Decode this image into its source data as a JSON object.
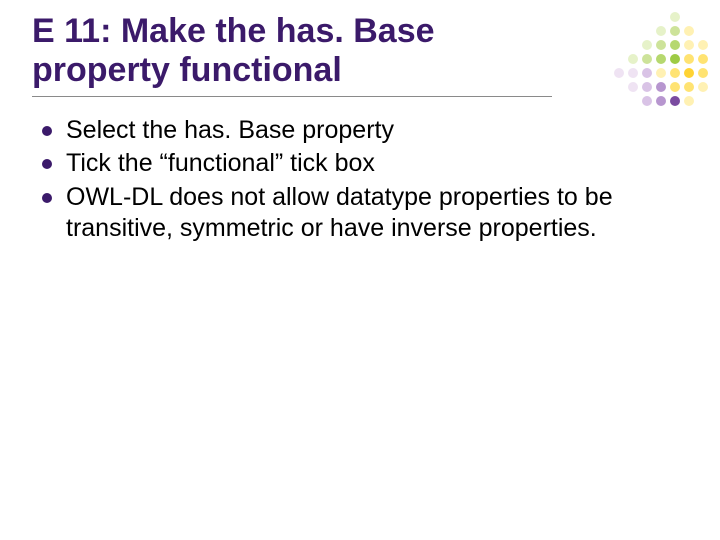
{
  "title": "E 11: Make the has. Base property functional",
  "bullets": [
    "Select the has. Base property",
    "Tick the “functional” tick box",
    "OWL-DL does not allow datatype properties to be transitive, symmetric or have inverse properties."
  ],
  "dot_grid": {
    "rows": 7,
    "cols": 7,
    "colors": {
      "blank": "transparent",
      "g1": "#e6f2c9",
      "g2": "#cde39a",
      "g3": "#b6d86f",
      "g4": "#9ecb45",
      "y1": "#fff1b3",
      "y2": "#ffe372",
      "y3": "#ffd333",
      "p1": "#efe3f3",
      "p2": "#d9c3e6",
      "p3": "#b796cf",
      "p4": "#7a4ba0"
    },
    "layout": [
      [
        "blank",
        "blank",
        "blank",
        "blank",
        "g1",
        "blank",
        "blank"
      ],
      [
        "blank",
        "blank",
        "blank",
        "g1",
        "g2",
        "y1",
        "blank"
      ],
      [
        "blank",
        "blank",
        "g1",
        "g2",
        "g3",
        "y1",
        "y1"
      ],
      [
        "blank",
        "g1",
        "g2",
        "g3",
        "g4",
        "y2",
        "y2"
      ],
      [
        "p1",
        "p1",
        "p2",
        "y1",
        "y2",
        "y3",
        "y2"
      ],
      [
        "blank",
        "p1",
        "p2",
        "p3",
        "y2",
        "y2",
        "y1"
      ],
      [
        "blank",
        "blank",
        "p2",
        "p3",
        "p4",
        "y1",
        "blank"
      ]
    ]
  }
}
